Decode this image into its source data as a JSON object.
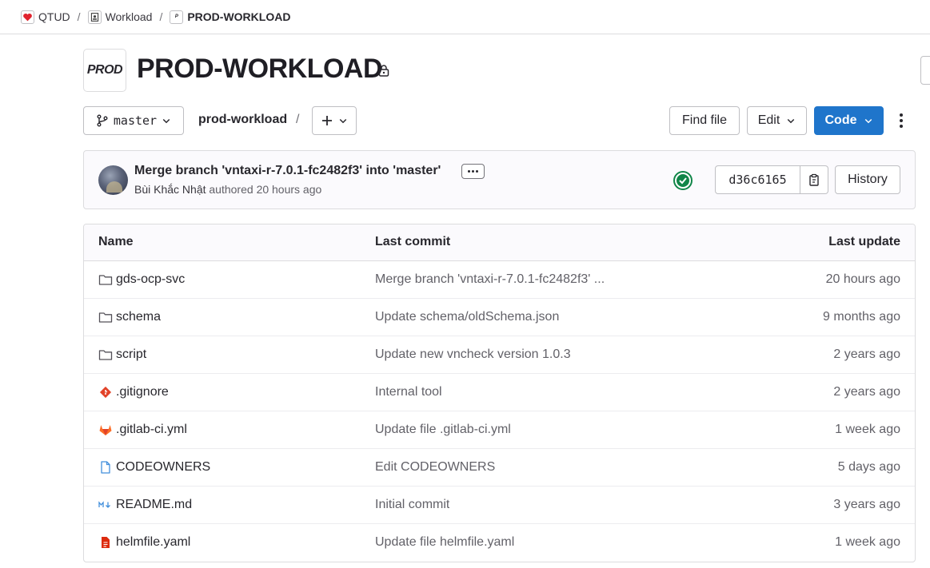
{
  "breadcrumb": [
    {
      "label": "QTUD",
      "icon": "heart-logo-icon"
    },
    {
      "label": "Workload",
      "icon": "group-logo-icon"
    },
    {
      "label": "PROD-WORKLOAD",
      "icon": "prod-logo-icon"
    }
  ],
  "project": {
    "avatar_text": "PROD",
    "title": "PROD-WORKLOAD",
    "visibility_icon": "lock-icon"
  },
  "toolbar": {
    "branch": "master",
    "path": "prod-workload",
    "path_separator": "/",
    "find_file": "Find file",
    "edit": "Edit",
    "code": "Code"
  },
  "commit": {
    "title": "Merge branch 'vntaxi-r-7.0.1-fc2482f3' into 'master'",
    "author": "Bùi Khắc Nhật",
    "action": "authored",
    "time": "20 hours ago",
    "sha": "d36c6165",
    "history": "History",
    "pipeline_status_color": "#108548"
  },
  "table": {
    "headers": {
      "name": "Name",
      "last_commit": "Last commit",
      "last_update": "Last update"
    },
    "rows": [
      {
        "name": "gds-ocp-svc",
        "icon": "folder-icon",
        "commit": "Merge branch 'vntaxi-r-7.0.1-fc2482f3' ...",
        "updated": "20 hours ago"
      },
      {
        "name": "schema",
        "icon": "folder-icon",
        "commit": "Update schema/oldSchema.json",
        "updated": "9 months ago"
      },
      {
        "name": "script",
        "icon": "folder-icon",
        "commit": "Update new vncheck version 1.0.3",
        "updated": "2 years ago"
      },
      {
        "name": ".gitignore",
        "icon": "git-icon",
        "commit": "Internal tool",
        "updated": "2 years ago"
      },
      {
        "name": ".gitlab-ci.yml",
        "icon": "gitlab-icon",
        "commit": "Update file .gitlab-ci.yml",
        "updated": "1 week ago"
      },
      {
        "name": "CODEOWNERS",
        "icon": "file-icon",
        "commit": "Edit CODEOWNERS",
        "updated": "5 days ago"
      },
      {
        "name": "README.md",
        "icon": "markdown-icon",
        "commit": "Initial commit",
        "updated": "3 years ago"
      },
      {
        "name": "helmfile.yaml",
        "icon": "yaml-file-icon",
        "commit": "Update file helmfile.yaml",
        "updated": "1 week ago"
      }
    ]
  },
  "colors": {
    "primary": "#1f75cb",
    "success": "#108548",
    "git": "#e24329",
    "gitlab": "#fc6d26",
    "file_blue": "#428fdc",
    "yaml_red": "#dd2b0e"
  }
}
